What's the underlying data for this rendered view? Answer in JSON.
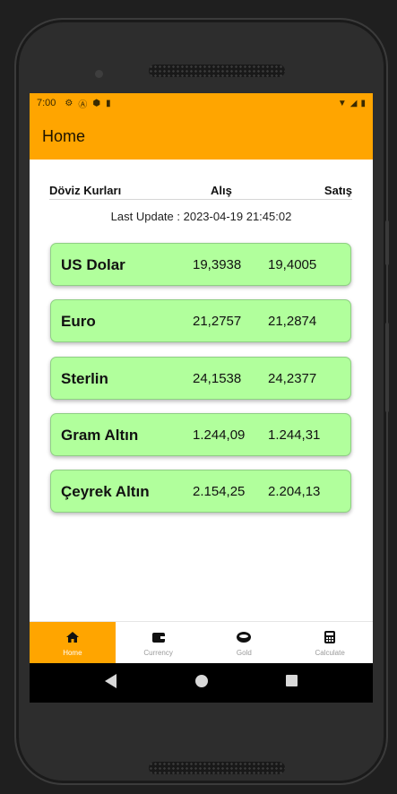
{
  "status_bar": {
    "time": "7:00"
  },
  "app_bar": {
    "title": "Home"
  },
  "table_header": {
    "col1": "Döviz Kurları",
    "col2": "Alış",
    "col3": "Satış"
  },
  "last_update": "Last Update : 2023-04-19 21:45:02",
  "rates": [
    {
      "name": "US Dolar",
      "buy": "19,3938",
      "sell": "19,4005"
    },
    {
      "name": "Euro",
      "buy": "21,2757",
      "sell": "21,2874"
    },
    {
      "name": "Sterlin",
      "buy": "24,1538",
      "sell": "24,2377"
    },
    {
      "name": "Gram Altın",
      "buy": "1.244,09",
      "sell": "1.244,31"
    },
    {
      "name": "Çeyrek Altın",
      "buy": "2.154,25",
      "sell": "2.204,13"
    }
  ],
  "bottom_nav": [
    {
      "label": "Home",
      "icon": "home-icon",
      "active": true
    },
    {
      "label": "Currency",
      "icon": "wallet-icon",
      "active": false
    },
    {
      "label": "Gold",
      "icon": "coin-icon",
      "active": false
    },
    {
      "label": "Calculate",
      "icon": "calculator-icon",
      "active": false
    }
  ],
  "colors": {
    "accent": "#ffa500",
    "card": "#b1ff9c"
  }
}
